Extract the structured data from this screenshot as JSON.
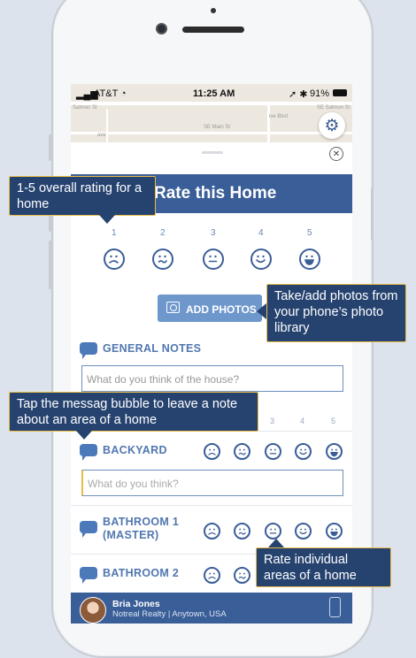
{
  "status_bar": {
    "carrier": "AT&T",
    "time": "11:25 AM",
    "battery": "91%"
  },
  "map": {
    "labels": [
      "Salmon St",
      "SE Main St",
      "SE Salmon St",
      "ave",
      "ive Blvd"
    ],
    "settings_icon": "gear-icon"
  },
  "sheet": {
    "title": "Rate this Home",
    "rating_numbers": [
      "1",
      "2",
      "3",
      "4",
      "5"
    ],
    "faces": [
      "very-sad-face-icon",
      "sad-face-icon",
      "neutral-face-icon",
      "happy-face-icon",
      "very-happy-face-icon"
    ],
    "add_photos_label": "ADD PHOTOS",
    "general_notes": {
      "label": "GENERAL NOTES",
      "placeholder": "What do you think of the house?"
    },
    "areas": [
      {
        "label": "BACKYARD",
        "placeholder": "What do you think?"
      },
      {
        "label": "BATHROOM 1 (MASTER)"
      },
      {
        "label": "BATHROOM 2"
      }
    ]
  },
  "footer": {
    "agent_name": "Bria Jones",
    "agent_company": "Notreal Realty | Anytown, USA"
  },
  "tooltips": {
    "overall": "1-5 overall rating for a home",
    "photos": "Take/add photos from your phone’s photo library",
    "bubble": "Tap the messag bubble to leave a note about an area of a home",
    "areas": "Rate individual areas of a home"
  },
  "colors": {
    "primary": "#3a5e97",
    "accent": "#6e97cc",
    "tooltip_bg": "#264370",
    "tooltip_border": "#e8bc48"
  }
}
